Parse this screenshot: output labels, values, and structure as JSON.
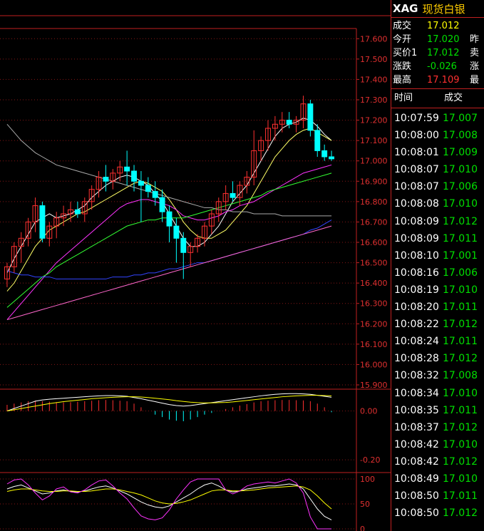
{
  "header": {
    "symbol": "XAG",
    "name": "现货白银"
  },
  "quote": [
    {
      "label": "成交",
      "value": "17.012",
      "color": "yellow",
      "right": ""
    },
    {
      "label": "今开",
      "value": "17.020",
      "color": "down",
      "right": "昨"
    },
    {
      "label": "买价1",
      "value": "17.012",
      "color": "down",
      "right": "卖"
    },
    {
      "label": "涨跌",
      "value": "-0.026",
      "color": "down",
      "right": "涨"
    },
    {
      "label": "最高",
      "value": "17.109",
      "color": "up",
      "right": "最"
    }
  ],
  "ticks_header": {
    "time": "时间",
    "price": "成交"
  },
  "ticks": [
    {
      "time": "10:07:59",
      "price": "17.007"
    },
    {
      "time": "10:08:00",
      "price": "17.008"
    },
    {
      "time": "10:08:01",
      "price": "17.009"
    },
    {
      "time": "10:08:07",
      "price": "17.010"
    },
    {
      "time": "10:08:07",
      "price": "17.006"
    },
    {
      "time": "10:08:08",
      "price": "17.010"
    },
    {
      "time": "10:08:09",
      "price": "17.012"
    },
    {
      "time": "10:08:09",
      "price": "17.011"
    },
    {
      "time": "10:08:10",
      "price": "17.001"
    },
    {
      "time": "10:08:16",
      "price": "17.006"
    },
    {
      "time": "10:08:19",
      "price": "17.010"
    },
    {
      "time": "10:08:20",
      "price": "17.011"
    },
    {
      "time": "10:08:22",
      "price": "17.012"
    },
    {
      "time": "10:08:24",
      "price": "17.011"
    },
    {
      "time": "10:08:28",
      "price": "17.012"
    },
    {
      "time": "10:08:32",
      "price": "17.008"
    },
    {
      "time": "10:08:34",
      "price": "17.010"
    },
    {
      "time": "10:08:35",
      "price": "17.011"
    },
    {
      "time": "10:08:37",
      "price": "17.012"
    },
    {
      "time": "10:08:42",
      "price": "17.010"
    },
    {
      "time": "10:08:42",
      "price": "17.012"
    },
    {
      "time": "10:08:49",
      "price": "17.010"
    },
    {
      "time": "10:08:50",
      "price": "17.011"
    },
    {
      "time": "10:08:50",
      "price": "17.012"
    }
  ],
  "colors": {
    "up": "#ff3030",
    "down": "#00ffff",
    "grid": "#c02020",
    "bg": "#000000"
  },
  "chart_data": [
    {
      "type": "candlestick",
      "ylim": [
        15.9,
        17.65
      ],
      "yticks": [
        "17.600",
        "17.500",
        "17.400",
        "17.300",
        "17.200",
        "17.100",
        "17.000",
        "16.900",
        "16.800",
        "16.700",
        "16.600",
        "16.500",
        "16.400",
        "16.300",
        "16.200",
        "16.100",
        "16.000",
        "15.900"
      ],
      "candles": [
        [
          16.42,
          16.5,
          16.38,
          16.48
        ],
        [
          16.48,
          16.6,
          16.45,
          16.58
        ],
        [
          16.58,
          16.65,
          16.5,
          16.62
        ],
        [
          16.62,
          16.72,
          16.58,
          16.7
        ],
        [
          16.7,
          16.82,
          16.65,
          16.78
        ],
        [
          16.78,
          16.8,
          16.6,
          16.62
        ],
        [
          16.62,
          16.7,
          16.58,
          16.68
        ],
        [
          16.68,
          16.75,
          16.62,
          16.72
        ],
        [
          16.72,
          16.78,
          16.68,
          16.74
        ],
        [
          16.74,
          16.8,
          16.7,
          16.76
        ],
        [
          16.76,
          16.8,
          16.72,
          16.74
        ],
        [
          16.74,
          16.82,
          16.7,
          16.8
        ],
        [
          16.8,
          16.88,
          16.76,
          16.86
        ],
        [
          16.86,
          16.95,
          16.82,
          16.92
        ],
        [
          16.92,
          16.98,
          16.85,
          16.9
        ],
        [
          16.9,
          16.96,
          16.86,
          16.94
        ],
        [
          16.94,
          17.0,
          16.9,
          16.97
        ],
        [
          16.97,
          17.05,
          16.88,
          16.95
        ],
        [
          16.95,
          16.98,
          16.85,
          16.9
        ],
        [
          16.9,
          16.95,
          16.7,
          16.88
        ],
        [
          16.88,
          16.92,
          16.82,
          16.85
        ],
        [
          16.85,
          16.9,
          16.78,
          16.82
        ],
        [
          16.82,
          16.86,
          16.7,
          16.75
        ],
        [
          16.75,
          16.78,
          16.6,
          16.68
        ],
        [
          16.68,
          16.72,
          16.5,
          16.62
        ],
        [
          16.62,
          16.65,
          16.42,
          16.55
        ],
        [
          16.55,
          16.6,
          16.48,
          16.58
        ],
        [
          16.58,
          16.64,
          16.55,
          16.62
        ],
        [
          16.62,
          16.7,
          16.58,
          16.68
        ],
        [
          16.68,
          16.76,
          16.64,
          16.74
        ],
        [
          16.74,
          16.82,
          16.7,
          16.8
        ],
        [
          16.8,
          16.88,
          16.76,
          16.84
        ],
        [
          16.84,
          16.9,
          16.8,
          16.82
        ],
        [
          16.82,
          16.9,
          16.78,
          16.88
        ],
        [
          16.88,
          16.95,
          16.84,
          16.92
        ],
        [
          16.92,
          17.15,
          16.88,
          17.05
        ],
        [
          17.05,
          17.12,
          17.0,
          17.1
        ],
        [
          17.1,
          17.2,
          17.05,
          17.16
        ],
        [
          17.16,
          17.22,
          17.1,
          17.18
        ],
        [
          17.18,
          17.24,
          17.14,
          17.2
        ],
        [
          17.2,
          17.24,
          17.16,
          17.18
        ],
        [
          17.18,
          17.22,
          17.14,
          17.2
        ],
        [
          17.2,
          17.32,
          17.16,
          17.28
        ],
        [
          17.28,
          17.3,
          17.12,
          17.15
        ],
        [
          17.15,
          17.18,
          17.02,
          17.05
        ],
        [
          17.05,
          17.08,
          17.0,
          17.02
        ],
        [
          17.02,
          17.05,
          17.0,
          17.01
        ]
      ],
      "ma": [
        {
          "name": "MA5",
          "color": "#ffffff",
          "values": [
            16.45,
            16.52,
            16.58,
            16.64,
            16.7,
            16.72,
            16.74,
            16.72,
            16.73,
            16.74,
            16.76,
            16.78,
            16.82,
            16.85,
            16.88,
            16.9,
            16.92,
            16.93,
            16.92,
            16.9,
            16.88,
            16.84,
            16.8,
            16.74,
            16.68,
            16.62,
            16.58,
            16.58,
            16.6,
            16.64,
            16.68,
            16.74,
            16.8,
            16.84,
            16.88,
            16.94,
            17.0,
            17.06,
            17.12,
            17.16,
            17.18,
            17.19,
            17.21,
            17.2,
            17.17,
            17.13,
            17.1
          ]
        },
        {
          "name": "MA10",
          "color": "#ffff66",
          "values": [
            16.36,
            16.4,
            16.46,
            16.52,
            16.58,
            16.62,
            16.66,
            16.68,
            16.7,
            16.72,
            16.74,
            16.75,
            16.77,
            16.79,
            16.81,
            16.83,
            16.85,
            16.87,
            16.89,
            16.9,
            16.89,
            16.87,
            16.85,
            16.81,
            16.76,
            16.7,
            16.66,
            16.63,
            16.62,
            16.62,
            16.64,
            16.66,
            16.7,
            16.74,
            16.78,
            16.84,
            16.9,
            16.96,
            17.02,
            17.06,
            17.1,
            17.13,
            17.15,
            17.16,
            17.14,
            17.12,
            17.1
          ]
        },
        {
          "name": "MA20",
          "color": "#ff33ff",
          "values": [
            16.22,
            16.26,
            16.3,
            16.34,
            16.38,
            16.42,
            16.46,
            16.5,
            16.53,
            16.56,
            16.59,
            16.62,
            16.65,
            16.68,
            16.71,
            16.74,
            16.77,
            16.79,
            16.8,
            16.81,
            16.81,
            16.8,
            16.79,
            16.78,
            16.76,
            16.73,
            16.72,
            16.71,
            16.71,
            16.72,
            16.73,
            16.75,
            16.76,
            16.78,
            16.79,
            16.8,
            16.82,
            16.84,
            16.86,
            16.88,
            16.9,
            16.92,
            16.94,
            16.95,
            16.96,
            16.97,
            16.98
          ]
        },
        {
          "name": "MA30",
          "color": "#33ff33",
          "values": [
            16.28,
            16.31,
            16.34,
            16.37,
            16.4,
            16.43,
            16.45,
            16.48,
            16.5,
            16.52,
            16.54,
            16.56,
            16.58,
            16.6,
            16.62,
            16.64,
            16.66,
            16.68,
            16.69,
            16.7,
            16.71,
            16.71,
            16.72,
            16.72,
            16.72,
            16.72,
            16.73,
            16.74,
            16.75,
            16.76,
            16.77,
            16.78,
            16.79,
            16.8,
            16.81,
            16.82,
            16.83,
            16.85,
            16.86,
            16.87,
            16.88,
            16.89,
            16.9,
            16.91,
            16.92,
            16.93,
            16.94
          ]
        },
        {
          "name": "MA60",
          "color": "#aaaaaa",
          "values": [
            17.18,
            17.14,
            17.1,
            17.07,
            17.04,
            17.02,
            17.0,
            16.98,
            16.97,
            16.96,
            16.95,
            16.94,
            16.93,
            16.92,
            16.91,
            16.9,
            16.89,
            16.88,
            16.87,
            16.86,
            16.85,
            16.84,
            16.83,
            16.82,
            16.81,
            16.8,
            16.79,
            16.78,
            16.77,
            16.77,
            16.76,
            16.76,
            16.75,
            16.75,
            16.75,
            16.74,
            16.74,
            16.74,
            16.74,
            16.73,
            16.73,
            16.73,
            16.73,
            16.73,
            16.73,
            16.73,
            16.73
          ]
        },
        {
          "name": "MA120",
          "color": "#3344ff",
          "values": [
            16.46,
            16.45,
            16.44,
            16.44,
            16.43,
            16.43,
            16.43,
            16.42,
            16.42,
            16.42,
            16.42,
            16.42,
            16.42,
            16.42,
            16.42,
            16.43,
            16.43,
            16.43,
            16.44,
            16.44,
            16.45,
            16.45,
            16.46,
            16.47,
            16.47,
            16.48,
            16.49,
            16.5,
            16.5,
            16.51,
            16.52,
            16.53,
            16.54,
            16.55,
            16.56,
            16.57,
            16.58,
            16.59,
            16.6,
            16.61,
            16.62,
            16.63,
            16.64,
            16.66,
            16.67,
            16.69,
            16.71
          ]
        },
        {
          "name": "MA250",
          "color": "#ff66cc",
          "values": [
            16.22,
            16.23,
            16.24,
            16.25,
            16.26,
            16.27,
            16.28,
            16.29,
            16.3,
            16.31,
            16.32,
            16.33,
            16.34,
            16.35,
            16.36,
            16.37,
            16.38,
            16.39,
            16.4,
            16.41,
            16.42,
            16.43,
            16.44,
            16.45,
            16.46,
            16.47,
            16.48,
            16.49,
            16.5,
            16.51,
            16.52,
            16.53,
            16.54,
            16.55,
            16.56,
            16.57,
            16.58,
            16.59,
            16.6,
            16.61,
            16.62,
            16.63,
            16.64,
            16.65,
            16.66,
            16.67,
            16.68
          ]
        }
      ]
    },
    {
      "type": "macd",
      "ylim": [
        -0.22,
        0.06
      ],
      "yticks": [
        "0.00",
        "-0.20"
      ],
      "bars": [
        0.025,
        0.03,
        0.035,
        0.04,
        0.042,
        0.04,
        0.038,
        0.036,
        0.035,
        0.036,
        0.038,
        0.04,
        0.042,
        0.044,
        0.045,
        0.044,
        0.042,
        0.04,
        0.03,
        0.015,
        0.0,
        -0.015,
        -0.025,
        -0.035,
        -0.04,
        -0.042,
        -0.035,
        -0.025,
        -0.015,
        -0.008,
        0.0,
        0.008,
        0.015,
        0.022,
        0.028,
        0.035,
        0.04,
        0.042,
        0.044,
        0.045,
        0.045,
        0.044,
        0.043,
        0.04,
        0.03,
        0.015,
        -0.005
      ],
      "dif": [
        0.0,
        0.01,
        0.02,
        0.03,
        0.04,
        0.045,
        0.048,
        0.05,
        0.052,
        0.054,
        0.056,
        0.058,
        0.06,
        0.062,
        0.063,
        0.063,
        0.062,
        0.06,
        0.055,
        0.05,
        0.044,
        0.038,
        0.032,
        0.026,
        0.022,
        0.02,
        0.022,
        0.026,
        0.03,
        0.034,
        0.038,
        0.042,
        0.046,
        0.05,
        0.054,
        0.058,
        0.062,
        0.065,
        0.068,
        0.07,
        0.071,
        0.071,
        0.07,
        0.068,
        0.064,
        0.06,
        0.056
      ],
      "dea": [
        0.0,
        0.005,
        0.01,
        0.015,
        0.02,
        0.025,
        0.03,
        0.034,
        0.038,
        0.041,
        0.044,
        0.047,
        0.05,
        0.052,
        0.054,
        0.056,
        0.057,
        0.058,
        0.058,
        0.057,
        0.055,
        0.052,
        0.049,
        0.046,
        0.042,
        0.039,
        0.036,
        0.034,
        0.033,
        0.033,
        0.034,
        0.035,
        0.037,
        0.04,
        0.043,
        0.046,
        0.049,
        0.052,
        0.055,
        0.058,
        0.06,
        0.062,
        0.063,
        0.064,
        0.064,
        0.063,
        0.062
      ]
    },
    {
      "type": "kdj",
      "ylim": [
        0,
        100
      ],
      "yticks": [
        "100",
        "50",
        "0"
      ],
      "k": [
        80,
        85,
        88,
        82,
        76,
        70,
        72,
        76,
        78,
        75,
        74,
        76,
        80,
        84,
        86,
        82,
        76,
        70,
        62,
        54,
        48,
        44,
        42,
        46,
        54,
        62,
        70,
        80,
        88,
        92,
        86,
        78,
        74,
        76,
        80,
        82,
        84,
        86,
        86,
        88,
        90,
        88,
        80,
        60,
        40,
        25,
        18
      ],
      "d": [
        75,
        78,
        80,
        80,
        78,
        76,
        75,
        75,
        76,
        76,
        75,
        75,
        76,
        78,
        80,
        80,
        78,
        75,
        72,
        68,
        62,
        56,
        52,
        50,
        51,
        54,
        58,
        64,
        70,
        76,
        78,
        78,
        76,
        76,
        77,
        78,
        80,
        82,
        83,
        84,
        85,
        86,
        84,
        78,
        66,
        52,
        40
      ],
      "j": [
        90,
        98,
        100,
        88,
        72,
        58,
        66,
        80,
        84,
        74,
        72,
        78,
        88,
        96,
        98,
        86,
        72,
        60,
        42,
        26,
        20,
        18,
        22,
        38,
        60,
        78,
        94,
        100,
        100,
        100,
        100,
        78,
        70,
        76,
        86,
        90,
        92,
        94,
        92,
        96,
        100,
        92,
        72,
        24,
        0,
        0,
        0
      ]
    }
  ]
}
